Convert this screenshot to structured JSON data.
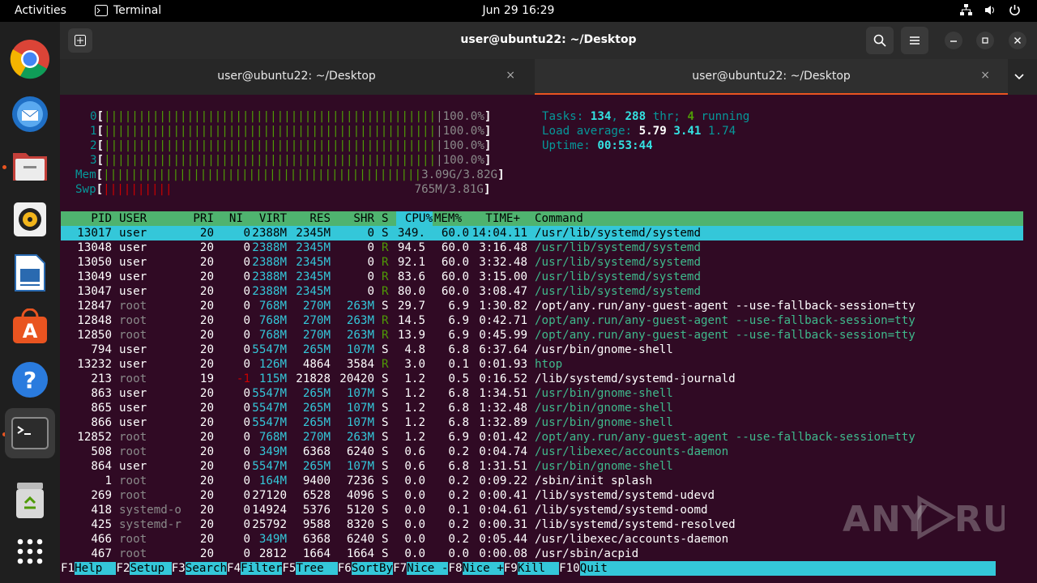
{
  "topbar": {
    "activities": "Activities",
    "app_name": "Terminal",
    "clock": "Jun 29  16:29"
  },
  "window": {
    "title": "user@ubuntu22: ~/Desktop"
  },
  "tabs": [
    {
      "label": "user@ubuntu22: ~/Desktop",
      "close": "×"
    },
    {
      "label": "user@ubuntu22: ~/Desktop",
      "close": "×"
    }
  ],
  "htop": {
    "cpus": [
      {
        "id": "0",
        "bar": "||||||||||||||||||||||||||||||||||||||||||||||||",
        "pct": "100.0%"
      },
      {
        "id": "1",
        "bar": "||||||||||||||||||||||||||||||||||||||||||||||||",
        "pct": "100.0%"
      },
      {
        "id": "2",
        "bar": "||||||||||||||||||||||||||||||||||||||||||||||||",
        "pct": "100.0%"
      },
      {
        "id": "3",
        "bar": "||||||||||||||||||||||||||||||||||||||||||||||||",
        "pct": "100.0%"
      }
    ],
    "mem": {
      "label": "Mem",
      "bar": "||||||||||||||||||||||||||||||||||||||||||||||",
      "value": "3.09G/3.82G"
    },
    "swp": {
      "label": "Swp",
      "bar": "||||||||||",
      "value": "765M/3.81G"
    },
    "tasks_label": "Tasks:",
    "tasks": "134",
    "thr": "288",
    "thr_label": "thr;",
    "running": "4",
    "running_label": "running",
    "load_label": "Load average:",
    "load1": "5.79",
    "load5": "3.41",
    "load15": "1.74",
    "uptime_label": "Uptime:",
    "uptime": "00:53:44",
    "columns": [
      "PID",
      "USER",
      "PRI",
      "NI",
      "VIRT",
      "RES",
      "SHR",
      "S",
      "CPU%",
      "MEM%",
      "TIME+",
      "Command"
    ],
    "processes": [
      [
        "13017",
        "user",
        "20",
        "0",
        "2388M",
        "2345M",
        "0",
        "S",
        "349.",
        "60.0",
        "14:04.11",
        "/usr/lib/systemd/systemd"
      ],
      [
        "13048",
        "user",
        "20",
        "0",
        "2388M",
        "2345M",
        "0",
        "R",
        "94.5",
        "60.0",
        "3:16.48",
        "/usr/lib/systemd/systemd"
      ],
      [
        "13050",
        "user",
        "20",
        "0",
        "2388M",
        "2345M",
        "0",
        "R",
        "92.1",
        "60.0",
        "3:32.48",
        "/usr/lib/systemd/systemd"
      ],
      [
        "13049",
        "user",
        "20",
        "0",
        "2388M",
        "2345M",
        "0",
        "R",
        "83.6",
        "60.0",
        "3:15.00",
        "/usr/lib/systemd/systemd"
      ],
      [
        "13047",
        "user",
        "20",
        "0",
        "2388M",
        "2345M",
        "0",
        "R",
        "80.0",
        "60.0",
        "3:08.47",
        "/usr/lib/systemd/systemd"
      ],
      [
        "12847",
        "root",
        "20",
        "0",
        "768M",
        "270M",
        "263M",
        "S",
        "29.7",
        "6.9",
        "1:30.82",
        "/opt/any.run/any-guest-agent --use-fallback-session=tty"
      ],
      [
        "12848",
        "root",
        "20",
        "0",
        "768M",
        "270M",
        "263M",
        "R",
        "14.5",
        "6.9",
        "0:42.71",
        "/opt/any.run/any-guest-agent --use-fallback-session=tty"
      ],
      [
        "12850",
        "root",
        "20",
        "0",
        "768M",
        "270M",
        "263M",
        "R",
        "13.9",
        "6.9",
        "0:45.99",
        "/opt/any.run/any-guest-agent --use-fallback-session=tty"
      ],
      [
        "794",
        "user",
        "20",
        "0",
        "5547M",
        "265M",
        "107M",
        "S",
        "4.8",
        "6.8",
        "6:37.64",
        "/usr/bin/gnome-shell"
      ],
      [
        "13232",
        "user",
        "20",
        "0",
        "126M",
        "4864",
        "3584",
        "R",
        "3.0",
        "0.1",
        "0:01.93",
        "htop"
      ],
      [
        "213",
        "root",
        "19",
        "-1",
        "115M",
        "21828",
        "20420",
        "S",
        "1.2",
        "0.5",
        "0:16.52",
        "/lib/systemd/systemd-journald"
      ],
      [
        "863",
        "user",
        "20",
        "0",
        "5547M",
        "265M",
        "107M",
        "S",
        "1.2",
        "6.8",
        "1:34.51",
        "/usr/bin/gnome-shell"
      ],
      [
        "865",
        "user",
        "20",
        "0",
        "5547M",
        "265M",
        "107M",
        "S",
        "1.2",
        "6.8",
        "1:32.48",
        "/usr/bin/gnome-shell"
      ],
      [
        "866",
        "user",
        "20",
        "0",
        "5547M",
        "265M",
        "107M",
        "S",
        "1.2",
        "6.8",
        "1:32.89",
        "/usr/bin/gnome-shell"
      ],
      [
        "12852",
        "root",
        "20",
        "0",
        "768M",
        "270M",
        "263M",
        "S",
        "1.2",
        "6.9",
        "0:01.42",
        "/opt/any.run/any-guest-agent --use-fallback-session=tty"
      ],
      [
        "508",
        "root",
        "20",
        "0",
        "349M",
        "6368",
        "6240",
        "S",
        "0.6",
        "0.2",
        "0:04.74",
        "/usr/libexec/accounts-daemon"
      ],
      [
        "864",
        "user",
        "20",
        "0",
        "5547M",
        "265M",
        "107M",
        "S",
        "0.6",
        "6.8",
        "1:31.51",
        "/usr/bin/gnome-shell"
      ],
      [
        "1",
        "root",
        "20",
        "0",
        "164M",
        "9400",
        "7236",
        "S",
        "0.0",
        "0.2",
        "0:09.22",
        "/sbin/init splash"
      ],
      [
        "269",
        "root",
        "20",
        "0",
        "27120",
        "6528",
        "4096",
        "S",
        "0.0",
        "0.2",
        "0:00.41",
        "/lib/systemd/systemd-udevd"
      ],
      [
        "418",
        "systemd-o",
        "20",
        "0",
        "14924",
        "5376",
        "5120",
        "S",
        "0.0",
        "0.1",
        "0:04.61",
        "/lib/systemd/systemd-oomd"
      ],
      [
        "425",
        "systemd-r",
        "20",
        "0",
        "25792",
        "9588",
        "8320",
        "S",
        "0.0",
        "0.2",
        "0:00.31",
        "/lib/systemd/systemd-resolved"
      ],
      [
        "466",
        "root",
        "20",
        "0",
        "349M",
        "6368",
        "6240",
        "S",
        "0.0",
        "0.2",
        "0:05.44",
        "/usr/libexec/accounts-daemon"
      ],
      [
        "467",
        "root",
        "20",
        "0",
        "2812",
        "1664",
        "1664",
        "S",
        "0.0",
        "0.0",
        "0:00.08",
        "/usr/sbin/acpid"
      ]
    ],
    "fkeys": [
      {
        "k": "F1",
        "l": "Help  "
      },
      {
        "k": "F2",
        "l": "Setup "
      },
      {
        "k": "F3",
        "l": "Search"
      },
      {
        "k": "F4",
        "l": "Filter"
      },
      {
        "k": "F5",
        "l": "Tree  "
      },
      {
        "k": "F6",
        "l": "SortBy"
      },
      {
        "k": "F7",
        "l": "Nice -"
      },
      {
        "k": "F8",
        "l": "Nice +"
      },
      {
        "k": "F9",
        "l": "Kill  "
      },
      {
        "k": "F10",
        "l": "Quit"
      }
    ]
  },
  "watermark": "ANY RUN",
  "colors": {
    "accent": "#e95420",
    "header_green": "#4fb36f",
    "selection_cyan": "#34c7d9",
    "terminal_bg": "#300a24"
  }
}
